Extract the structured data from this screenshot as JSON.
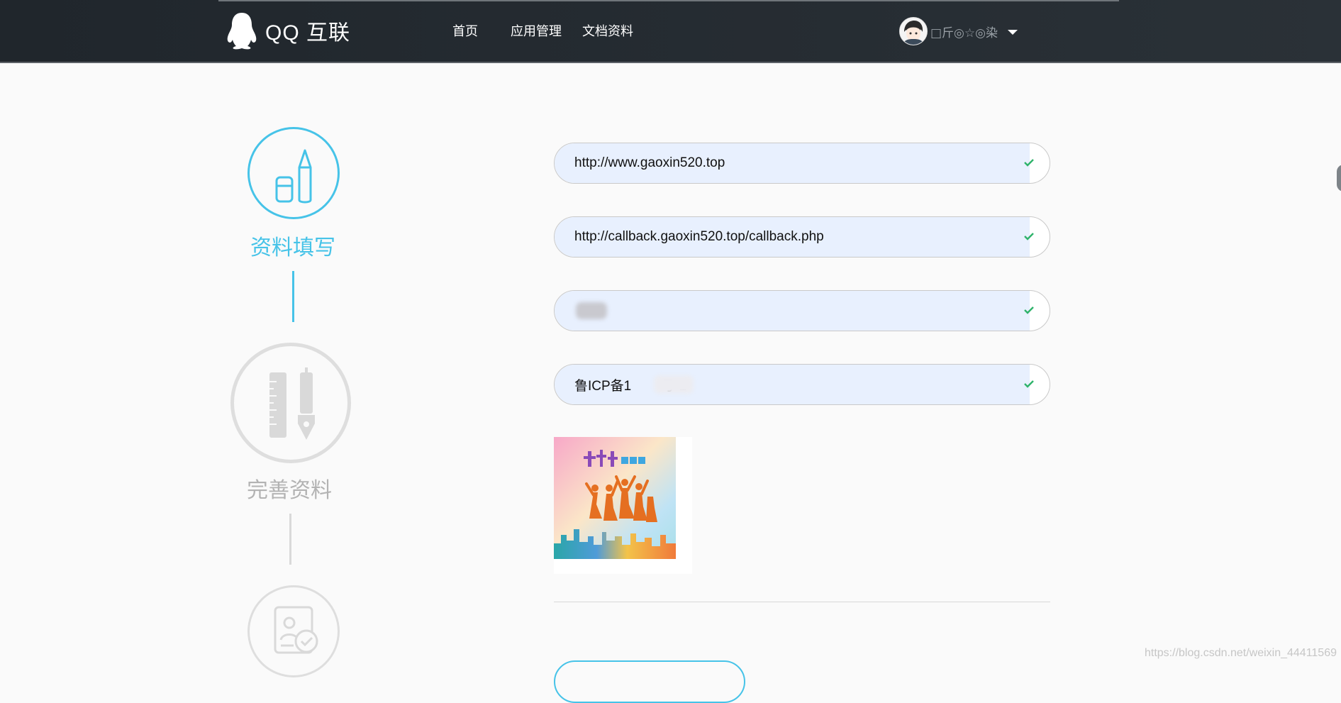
{
  "nav": {
    "logo_text": "QQ 互联",
    "links": [
      "首页",
      "应用管理",
      "文档资料"
    ],
    "username": "□斤◎☆◎染"
  },
  "steps": [
    {
      "label": "资料填写",
      "state": "active",
      "icon": "pencil-eraser-icon"
    },
    {
      "label": "完善资料",
      "state": "inactive",
      "icon": "ruler-pen-icon"
    },
    {
      "label": "",
      "state": "inactive",
      "icon": "document-check-icon"
    }
  ],
  "form": {
    "fields": [
      {
        "value": "http://www.gaoxin520.top"
      },
      {
        "value": "http://callback.gaoxin520.top/callback.php"
      },
      {
        "value": ""
      },
      {
        "value": "鲁ICP备1        号-1"
      }
    ],
    "upload_image": "school-season-banner-image"
  },
  "watermark": "https://blog.csdn.net/weixin_44411569",
  "colors": {
    "accent": "#46c3e8",
    "inactive": "#d9d9d9",
    "check": "#2fb36b",
    "nav_bg": "#22292f",
    "autofill": "#e8f0fe"
  }
}
